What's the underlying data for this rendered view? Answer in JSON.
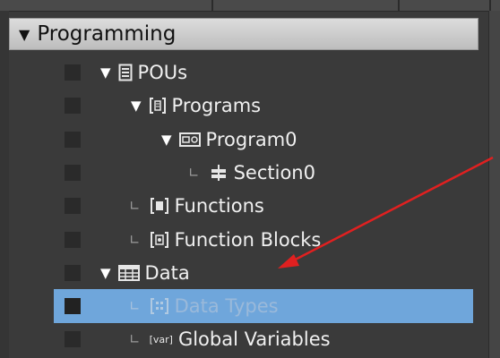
{
  "panel": {
    "title": "Programming",
    "expand_glyph": "▼"
  },
  "tree": [
    {
      "label": "POUs",
      "icon": "document-list-icon",
      "expanded": true,
      "expander": "▼",
      "selected": false
    },
    {
      "label": "Programs",
      "icon": "bracket-list-icon",
      "expanded": true,
      "expander": "▼",
      "selected": false
    },
    {
      "label": "Program0",
      "icon": "program-block-icon",
      "expanded": true,
      "expander": "▼",
      "selected": false
    },
    {
      "label": "Section0",
      "icon": "section-icon",
      "expanded": false,
      "connector": "∟",
      "selected": false
    },
    {
      "label": "Functions",
      "icon": "function-bracket-icon",
      "expanded": false,
      "connector": "∟",
      "selected": false
    },
    {
      "label": "Function Blocks",
      "icon": "function-block-bracket-icon",
      "expanded": false,
      "connector": "∟",
      "selected": false
    },
    {
      "label": "Data",
      "icon": "table-grid-icon",
      "expanded": true,
      "expander": "▼",
      "selected": false
    },
    {
      "label": "Data Types",
      "icon": "data-types-icon",
      "expanded": false,
      "connector": "∟",
      "selected": true
    },
    {
      "label": "Global Variables",
      "icon": "var-icon",
      "icon_text": "[var]",
      "expanded": false,
      "connector": "∟",
      "selected": false
    }
  ],
  "colors": {
    "background": "#3a3a3a",
    "header": "#cfcfcf",
    "selection": "#6fa6db",
    "annotation_arrow": "#e02020"
  }
}
